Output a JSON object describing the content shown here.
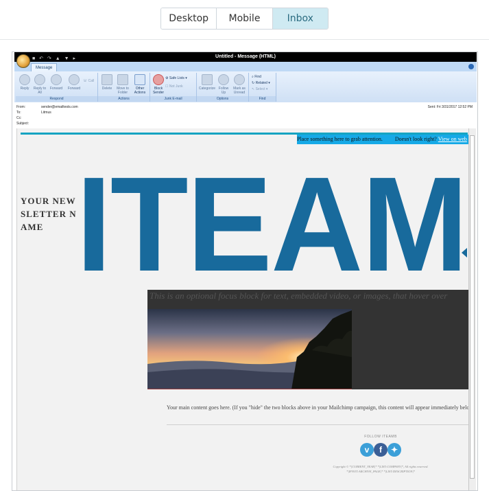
{
  "device_tabs": [
    {
      "label": "Desktop",
      "active": false
    },
    {
      "label": "Mobile",
      "active": false
    },
    {
      "label": "Inbox",
      "active": true
    }
  ],
  "window": {
    "title": "Untitled - Message (HTML)",
    "ribbon_tab": "Message"
  },
  "ribbon": {
    "respond": {
      "label": "Respond",
      "reply": "Reply",
      "reply_all": "Reply to All",
      "forward": "Forward",
      "call": "Call"
    },
    "actions": {
      "label": "Actions",
      "delete": "Delete",
      "move": "Move to Folder",
      "other": "Other Actions"
    },
    "junk": {
      "label": "Junk E-mail",
      "block": "Block Sender",
      "safe": "Safe Lists",
      "not_junk": "Not Junk"
    },
    "options": {
      "label": "Options",
      "categorize": "Categorize",
      "follow_up": "Follow Up",
      "mark_unread": "Mark as Unread"
    },
    "find": {
      "label": "Find",
      "find": "Find",
      "related": "Related",
      "select": "Select"
    }
  },
  "headers": {
    "from_label": "From:",
    "from_value": "sender@emailtests.com",
    "to_label": "To:",
    "to_value": "Litmus",
    "cc_label": "Cc:",
    "subject_label": "Subject:",
    "sent": "Sent:   Fri 3/31/2017 12:52 PM"
  },
  "email": {
    "preheader_text": "Place something here to grab attention.",
    "preheader_question": "Doesn't look right?",
    "preheader_link": "View on web",
    "newsletter_name": "YOUR NEWSLETTER NAME",
    "logo_text": "ITEAM",
    "focus_text": "This is an optional focus block for text, embedded video, or images, that hover over",
    "main_content": "Your main content goes here. (If you \"hide\" the two blocks above in your Mailchimp campaign, this content will appear immediately below the header.)",
    "follow_label": "FOLLOW ITEAMB",
    "copyright": "Copyright © *|CURRENT_YEAR|* *|LIST:COMPANY|*, All rights reserved.",
    "archive": "*|IFNOT:ARCHIVE_PAGE|* *|LIST:DESCRIPTION|*"
  },
  "social_icons": [
    "vimeo-icon",
    "facebook-icon",
    "twitter-icon"
  ],
  "colors": {
    "accent_blue": "#186a9c",
    "preheader_bg": "#16a9e6",
    "tab_active_bg": "#cfeaf2",
    "dark_block": "#333333"
  }
}
